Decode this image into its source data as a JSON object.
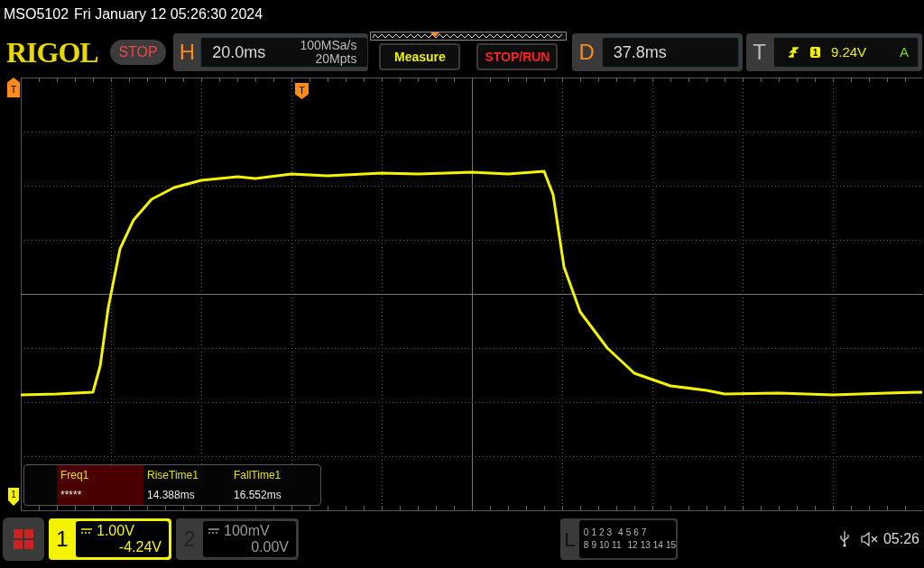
{
  "header": {
    "model": "MSO5102",
    "datetime": "Fri January 12 05:26:30 2024"
  },
  "toolbar": {
    "logo": "RIGOL",
    "run_state": "STOP",
    "horizontal": {
      "label": "H",
      "timebase": "20.0ms",
      "sample_rate": "100MSa/s",
      "memory_depth": "20Mpts"
    },
    "buttons": [
      {
        "label": "Measure",
        "kind": "measure"
      },
      {
        "label": "STOP/RUN",
        "kind": "run"
      }
    ],
    "delay": {
      "label": "D",
      "value": "37.8ms"
    },
    "trigger": {
      "label": "T",
      "source": "1",
      "level": "9.24V",
      "mode": "A"
    }
  },
  "plot": {
    "trigger_level_marker": "T",
    "trigger_position_marker": "T",
    "channel_marker": "1"
  },
  "measurements": [
    {
      "name": "Freq1",
      "value": "*****",
      "selected": true
    },
    {
      "name": "RiseTime1",
      "value": "14.388ms",
      "selected": false
    },
    {
      "name": "FallTime1",
      "value": "16.552ms",
      "selected": false
    }
  ],
  "channels": [
    {
      "number": "1",
      "scale": "1.00V",
      "offset": "-4.24V",
      "active": true
    },
    {
      "number": "2",
      "scale": "100mV",
      "offset": "0.00V",
      "active": false
    }
  ],
  "logic": {
    "label": "L",
    "row_1": [
      "0",
      "1",
      "2",
      "3",
      "4",
      "5",
      "6",
      "7"
    ],
    "row_2": [
      "8",
      "9",
      "10",
      "11",
      "12",
      "13",
      "14",
      "15"
    ]
  },
  "status_bar": {
    "time": "05:26"
  }
}
